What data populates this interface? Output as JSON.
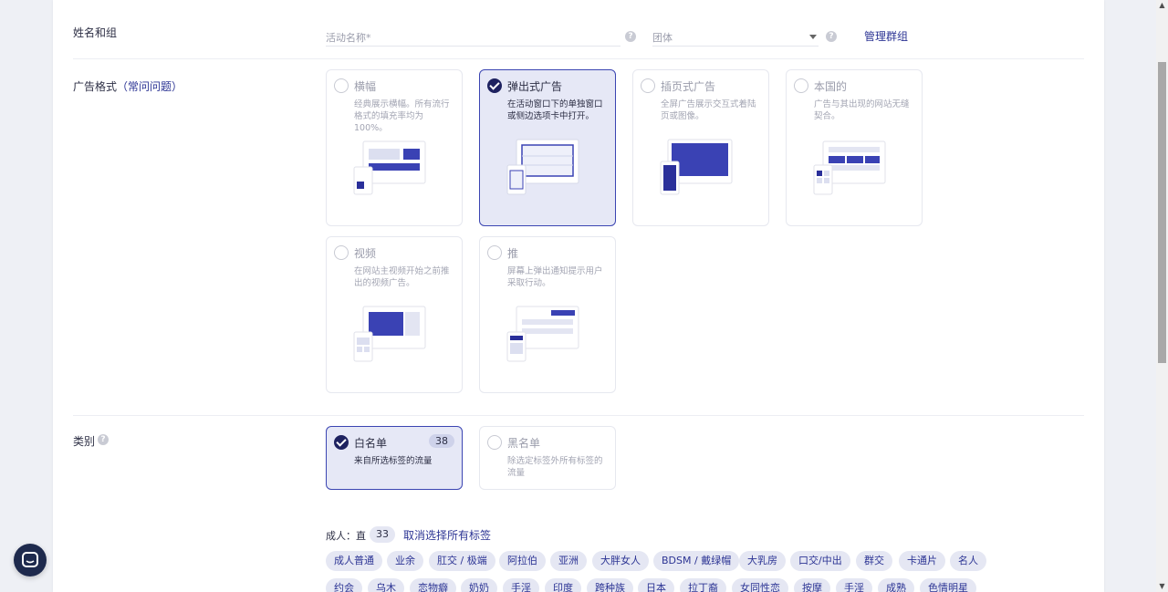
{
  "name_group": {
    "label": "姓名和组",
    "campaign_placeholder": "活动名称*",
    "group_placeholder": "团体",
    "manage_groups": "管理群组"
  },
  "ad_format": {
    "label": "广告格式",
    "faq_link": "（常问问题）",
    "cards": [
      {
        "title": "横幅",
        "desc": "经典展示横幅。所有流行格式的填充率均为 100%。",
        "selected": false
      },
      {
        "title": "弹出式广告",
        "desc": "在活动窗口下的单独窗口或侧边选项卡中打开。",
        "selected": true
      },
      {
        "title": "插页式广告",
        "desc": "全屏广告展示交互式着陆页或图像。",
        "selected": false
      },
      {
        "title": "本国的",
        "desc": "广告与其出现的网站无缝契合。",
        "selected": false
      },
      {
        "title": "视频",
        "desc": "在网站主视频开始之前推出的视频广告。",
        "selected": false
      },
      {
        "title": "推",
        "desc": "屏幕上弹出通知提示用户采取行动。",
        "selected": false
      }
    ]
  },
  "category": {
    "label": "类别",
    "whitelist": {
      "title": "白名单",
      "count": "38",
      "desc": "来自所选标签的流量"
    },
    "blacklist": {
      "title": "黑名单",
      "desc": "除选定标签外所有标签的流量"
    }
  },
  "tags": {
    "group_label": "成人：直",
    "group_count": "33",
    "deselect_all": "取消选择所有标签",
    "row1": [
      "成人普通",
      "业余",
      "肛交 / 极端",
      "阿拉伯",
      "亚洲",
      "大胖女人",
      "BDSM / 戴绿帽",
      "大乳房",
      "口交/中出",
      "群交",
      "卡通片",
      "名人"
    ],
    "row2": [
      "约会",
      "乌木",
      "恋物癖",
      "奶奶",
      "手淫",
      "印度",
      "跨种族",
      "日本",
      "拉丁裔",
      "女同性恋",
      "按摩",
      "手淫",
      "成熟",
      "色情明星"
    ]
  },
  "colors": {
    "accent": "#2c3494",
    "selected_bg": "#e6e8f6",
    "tag_bg": "#e5e7f3",
    "check": "#1e2260"
  }
}
